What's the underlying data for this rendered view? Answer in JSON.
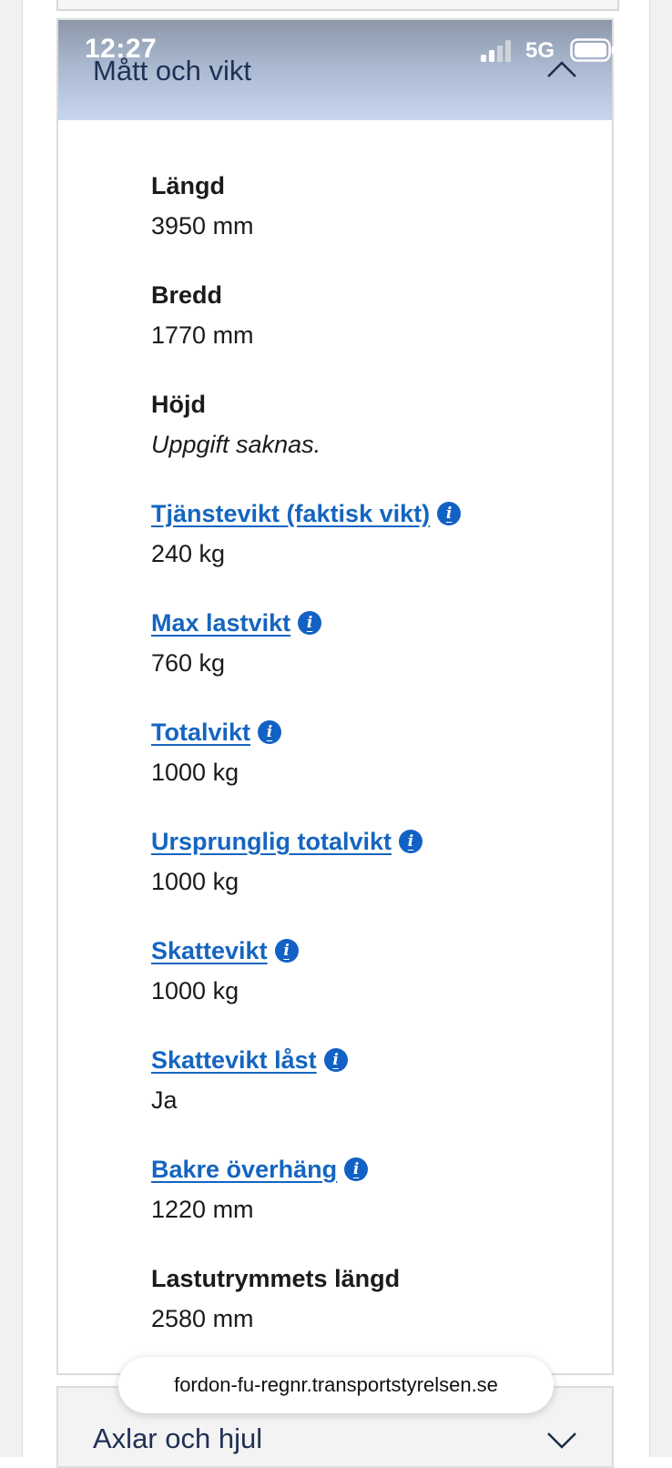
{
  "status_bar": {
    "time": "12:27",
    "network": "5G"
  },
  "section": {
    "title": "Mått och vikt",
    "fields": [
      {
        "label": "Längd",
        "value": "3950 mm",
        "link": false
      },
      {
        "label": "Bredd",
        "value": "1770 mm",
        "link": false
      },
      {
        "label": "Höjd",
        "value": "Uppgift saknas.",
        "link": false,
        "missing": true
      },
      {
        "label": "Tjänstevikt (faktisk vikt)",
        "value": "240 kg",
        "link": true
      },
      {
        "label": "Max lastvikt",
        "value": "760 kg",
        "link": true
      },
      {
        "label": "Totalvikt",
        "value": "1000 kg",
        "link": true
      },
      {
        "label": "Ursprunglig totalvikt",
        "value": "1000 kg",
        "link": true
      },
      {
        "label": "Skattevikt",
        "value": "1000 kg",
        "link": true
      },
      {
        "label": "Skattevikt låst",
        "value": "Ja",
        "link": true
      },
      {
        "label": "Bakre överhäng",
        "value": "1220 mm",
        "link": true
      },
      {
        "label": "Lastutrymmets längd",
        "value": "2580 mm",
        "link": false
      }
    ]
  },
  "next_section": {
    "title": "Axlar och hjul"
  },
  "browser": {
    "url": "fordon-fu-regnr.transportstyrelsen.se"
  },
  "colors": {
    "link": "#1565c0",
    "info_icon": "#1261c4",
    "header_text": "#203155"
  }
}
